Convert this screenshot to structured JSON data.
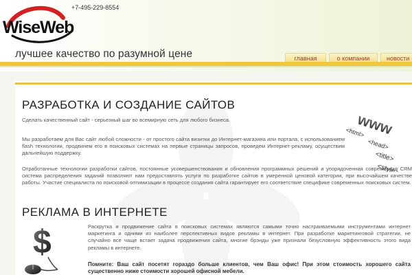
{
  "header": {
    "logo_text": "WiseWeb",
    "phone": "+7-495-229-8554",
    "slogan": "лучшее качество по разумной цене"
  },
  "nav": {
    "items": [
      {
        "label": "главная"
      },
      {
        "label": "о компании"
      },
      {
        "label": "новости"
      }
    ]
  },
  "sections": {
    "dev": {
      "title": "РАЗРАБОТКА И СОЗДАНИЕ САЙТОВ",
      "p1": "Сделать качественный сайт - серьезный шаг во всемирную сеть для любого бизнеса.",
      "p2": "Мы разработаем для Вас сайт любой сложности - от простого сайта визитки до Интернет-магазина или портала, с использованием flash технологии, продвинем его в поисковых системах на первые страницы запросов, проведем Интернет-рекламу, осуществим дальнейшую поддержку.",
      "p3": "Отработанные технологии разработки сайтов, постоянные усовершенствования и обновления программных решений и упорядоченная современная CRM система распределения заданий позволяют нам предоставлять услуги по разработке сайтов в умеренной ценовой категории, при высочайшем качестве работы. Участие специалиста по поисковой оптимизации в процессе создания сайта гарантирует его соответствие специфике современных поисковых систем."
    },
    "ads": {
      "title": "РЕКЛАМА В ИНТЕРНЕТЕ",
      "p1": "Раскрутка и продвижение сайта в поисковых системах являются самыми точно настраиваемыми инструментами интернет маркетинга и одними из наиболее перспективных видов рекламы в интернет. При разработке маркетинговой стратегии, не случайно все чаще встает задача продвижения сайта, многие брэнды уже признали безусловную эффективность этого вида рекламы в интернете.",
      "p2": "Помните: Ваш сайт посетят гораздо больше клиентов, чем Ваш офис! При этом стоимость хорошего сайта существенно ниже стоимости хорошей офисной мебели."
    }
  },
  "images": {
    "www_labels": [
      "www",
      "<html>",
      "<head>",
      "<title>",
      "<style>"
    ]
  },
  "colors": {
    "accent": "#f0c73c",
    "logo_red": "#d42020",
    "nav_text": "#a04040"
  }
}
